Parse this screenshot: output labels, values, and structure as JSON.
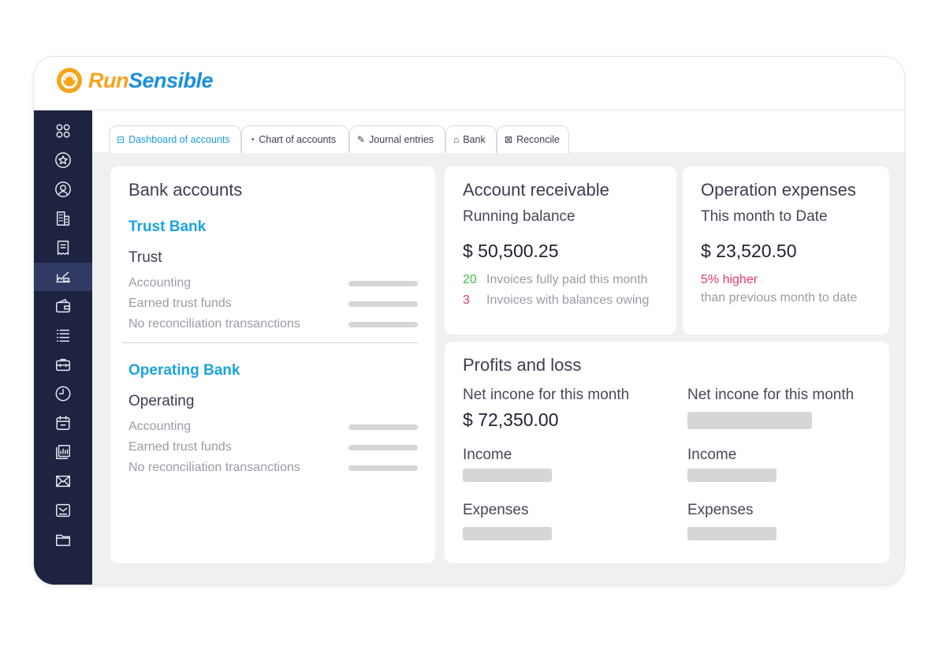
{
  "app": {
    "logo_part1": "Run",
    "logo_part2": "Sensible"
  },
  "sidebar": {
    "items": [
      {
        "icon": "apps-icon"
      },
      {
        "icon": "star-badge-icon"
      },
      {
        "icon": "contact-icon"
      },
      {
        "icon": "building-icon"
      },
      {
        "icon": "receipt-icon"
      },
      {
        "icon": "accounting-icon",
        "active": true
      },
      {
        "icon": "wallet-icon"
      },
      {
        "icon": "list-icon"
      },
      {
        "icon": "briefcase-icon"
      },
      {
        "icon": "clock-icon"
      },
      {
        "icon": "calendar-icon"
      },
      {
        "icon": "reports-icon"
      },
      {
        "icon": "mail-icon"
      },
      {
        "icon": "inbox-icon"
      },
      {
        "icon": "folder-icon"
      }
    ]
  },
  "tabs": [
    {
      "label": "Dashboard of accounts",
      "icon": "dashboard-icon",
      "active": true
    },
    {
      "label": "Chart of accounts",
      "icon": "pie-chart-icon"
    },
    {
      "label": "Journal entries",
      "icon": "edit-icon"
    },
    {
      "label": "Bank",
      "icon": "bank-icon"
    },
    {
      "label": "Reconcile",
      "icon": "reconcile-icon"
    }
  ],
  "bank_accounts": {
    "title": "Bank accounts",
    "trust": {
      "name": "Trust Bank",
      "type": "Trust",
      "rows": [
        "Accounting",
        "Earned trust funds",
        "No reconciliation transanctions"
      ]
    },
    "operating": {
      "name": "Operating Bank",
      "type": "Operating",
      "rows": [
        "Accounting",
        "Earned trust funds",
        "No reconciliation transanctions"
      ]
    }
  },
  "receivable": {
    "title": "Account receivable",
    "subtitle": "Running balance",
    "amount": "$ 50,500.25",
    "paid_count": "20",
    "paid_label": "Invoices fully paid this month",
    "owing_count": "3",
    "owing_label": "Invoices with balances owing"
  },
  "expenses": {
    "title": "Operation expenses",
    "subtitle": "This month to Date",
    "amount": "$ 23,520.50",
    "change": "5% higher",
    "change_note": "than previous month to date"
  },
  "pnl": {
    "title": "Profits and loss",
    "left": {
      "net_label": "Net incone for this month",
      "net_amount": "$ 72,350.00",
      "income": "Income",
      "expenses": "Expenses"
    },
    "right": {
      "net_label": "Net incone for this month",
      "income": "Income",
      "expenses": "Expenses"
    }
  },
  "colors": {
    "sidebar": "#1d2340",
    "accent": "#1aa4df",
    "positive": "#3bbf4a",
    "negative": "#e33a6a",
    "logo_orange": "#f7a41d"
  }
}
